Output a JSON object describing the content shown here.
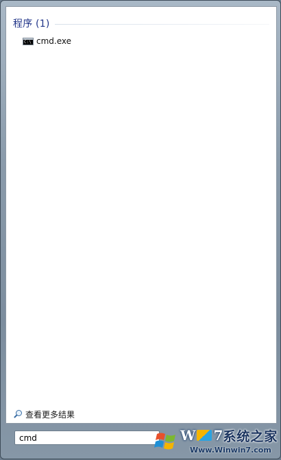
{
  "results": {
    "group_title": "程序 (1)",
    "items": [
      {
        "label": "cmd.exe",
        "icon": "console-icon"
      }
    ]
  },
  "more_results": {
    "label": "查看更多结果",
    "icon": "search-icon"
  },
  "search": {
    "value": "cmd"
  },
  "watermark": {
    "brand_prefix": "W",
    "brand_suffix": "7",
    "brand_cn": "系统之家",
    "url": "Www.Winwin7.com"
  },
  "colors": {
    "group_title": "#1e3287",
    "frame": "#8a9bab",
    "pane": "#ffffff"
  }
}
